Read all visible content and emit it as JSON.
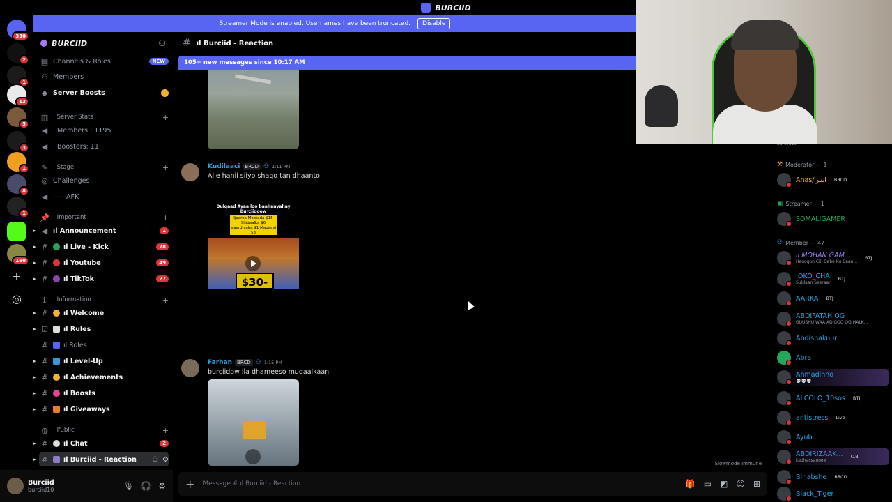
{
  "window": {
    "title": "BURCIID"
  },
  "banner": {
    "text": "Streamer Mode is enabled. Usernames have been truncated.",
    "button": "Disable"
  },
  "guilds": [
    {
      "badge": "330"
    },
    {
      "badge": "2"
    },
    {
      "badge": "1"
    },
    {
      "badge": "13"
    },
    {
      "badge": "5"
    },
    {
      "badge": "3"
    },
    {
      "badge": "1"
    },
    {
      "badge": "8"
    },
    {
      "badge": "1"
    },
    {
      "badge": ""
    },
    {
      "badge": "160"
    }
  ],
  "server": {
    "name": "BURCIID",
    "items": [
      {
        "label": "Channels & Roles",
        "tag": "NEW"
      },
      {
        "label": "Members"
      },
      {
        "label": "Server Boosts"
      }
    ],
    "categories": {
      "stats": "| Server Stats",
      "stage": "| Stage",
      "important": "| Important",
      "information": "| Information",
      "public": "| Public"
    },
    "stats": [
      "⋅ Members : 1195",
      "⋅ Boosters: 11"
    ],
    "stage": [
      "Challenges",
      "——AFK"
    ],
    "important": [
      {
        "label": "ıl Announcement",
        "count": "1",
        "color": "#da373c"
      },
      {
        "label": "ıl Live - Kick",
        "count": "78",
        "color": "#23a55a"
      },
      {
        "label": "ıl Youtube",
        "count": "49",
        "color": "#da373c"
      },
      {
        "label": "ıl TikTok",
        "count": "27",
        "color": "#8e44ad"
      }
    ],
    "information": [
      {
        "label": "ıl Welcome"
      },
      {
        "label": "ıl Rules"
      },
      {
        "label": "ıl Roles"
      },
      {
        "label": "ıl Level-Up"
      },
      {
        "label": "ıl Achievements"
      },
      {
        "label": "ıl Boosts"
      },
      {
        "label": "ıl Giveaways"
      }
    ],
    "public": [
      {
        "label": "ıl Chat",
        "count": "2"
      },
      {
        "label": "ıl Burciid - Reaction"
      }
    ]
  },
  "user": {
    "name": "Burciid",
    "status": "burciid10"
  },
  "channel": {
    "name": "ıl Burciid - Reaction"
  },
  "new_messages": "105+ new messages since 10:17 AM",
  "messages": [
    {
      "author": "Kudilaaci",
      "tag": "BRCD",
      "time": "1:11 PM",
      "text": "Alle hanii siiyo shaqo tan dhaanto",
      "tiktok": {
        "caption1": "Dulqaad Ayaa loo baahanyahay Burciidoow",
        "caption2": "Ijaarka Mootada $15\nShidaalka $6\nwaardiyaha $1\nMaqaaxi $3",
        "price": "$30-"
      }
    },
    {
      "author": "Farhan",
      "tag": "BRCD",
      "time": "1:15 PM",
      "text": "burciidow ila dhameeso muqaalkaan"
    }
  ],
  "composer": {
    "placeholder": "Message # ıl Burciid - Reaction"
  },
  "slowmode": "Slowmode Immune",
  "members": {
    "groups": {
      "moderator": "Moderator — 1",
      "streamer": "Streamer — 1",
      "member": "Member — 47"
    },
    "top_sub": "burciid10",
    "moderator": [
      {
        "name": "Anas/انس",
        "tag": "BRCD",
        "color": "#f0b232"
      }
    ],
    "streamer": [
      {
        "name": "SOMALIGAMER",
        "color": "#23a55a"
      }
    ],
    "list": [
      {
        "name": "ıl MOHAN GAM...",
        "tag": "BTJ",
        "sub": "Hanoqon Ciil Qabe Ku Caan..."
      },
      {
        "name": ".OKO_CHA",
        "tag": "BTJ",
        "sub": "Suldaan Seeraar"
      },
      {
        "name": "AARKA",
        "tag": "BTJ",
        "sub": ""
      },
      {
        "name": "ABDIFATAH OG",
        "tag": "",
        "sub": "GUUSHU WAA ADIGOO OG HALK..."
      },
      {
        "name": "Abdishakuur",
        "tag": "",
        "sub": ""
      },
      {
        "name": "Abra",
        "tag": "",
        "sub": ""
      },
      {
        "name": "Ahmadinho",
        "tag": "",
        "sub": "💀💀💀"
      },
      {
        "name": "ALCOLO_10sos",
        "tag": "BTJ",
        "sub": ""
      },
      {
        "name": "antistress",
        "tag": "Live",
        "sub": ""
      },
      {
        "name": "Ayub",
        "tag": "",
        "sub": ""
      },
      {
        "name": "ABDIRIZAAK...",
        "tag": "C.B",
        "sub": "kadhacsanoow"
      },
      {
        "name": "Birjabshe",
        "tag": "BRCD",
        "sub": ""
      },
      {
        "name": "Black_Tiger",
        "tag": "",
        "sub": ""
      }
    ]
  }
}
